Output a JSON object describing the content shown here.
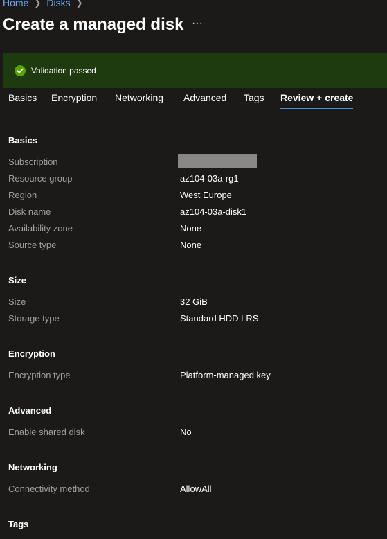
{
  "breadcrumb": {
    "home": "Home",
    "disks": "Disks"
  },
  "page": {
    "title": "Create a managed disk",
    "more_label": "···"
  },
  "banner": {
    "message": "Validation passed",
    "color": "#1e3a0f",
    "icon": "check-circle-icon"
  },
  "tabs": [
    {
      "label": "Basics"
    },
    {
      "label": "Encryption"
    },
    {
      "label": "Networking"
    },
    {
      "label": "Advanced"
    },
    {
      "label": "Tags"
    },
    {
      "label": "Review + create",
      "active": true
    }
  ],
  "sections": {
    "basics": {
      "heading": "Basics",
      "rows": [
        {
          "label": "Subscription",
          "value": "",
          "redacted": true
        },
        {
          "label": "Resource group",
          "value": "az104-03a-rg1"
        },
        {
          "label": "Region",
          "value": "West Europe"
        },
        {
          "label": "Disk name",
          "value": "az104-03a-disk1"
        },
        {
          "label": "Availability zone",
          "value": "None"
        },
        {
          "label": "Source type",
          "value": "None"
        }
      ]
    },
    "size": {
      "heading": "Size",
      "rows": [
        {
          "label": "Size",
          "value": "32 GiB"
        },
        {
          "label": "Storage type",
          "value": "Standard HDD LRS"
        }
      ]
    },
    "encryption": {
      "heading": "Encryption",
      "rows": [
        {
          "label": "Encryption type",
          "value": "Platform-managed key"
        }
      ]
    },
    "advanced": {
      "heading": "Advanced",
      "rows": [
        {
          "label": "Enable shared disk",
          "value": "No"
        }
      ]
    },
    "networking": {
      "heading": "Networking",
      "rows": [
        {
          "label": "Connectivity method",
          "value": "AllowAll"
        }
      ]
    },
    "tags": {
      "heading": "Tags"
    }
  },
  "colors": {
    "background": "#1b1a19",
    "link": "#6ea8ff",
    "label": "#a19f9d",
    "success": "#57a300",
    "active_tab_underline": "#4f8ee6"
  }
}
